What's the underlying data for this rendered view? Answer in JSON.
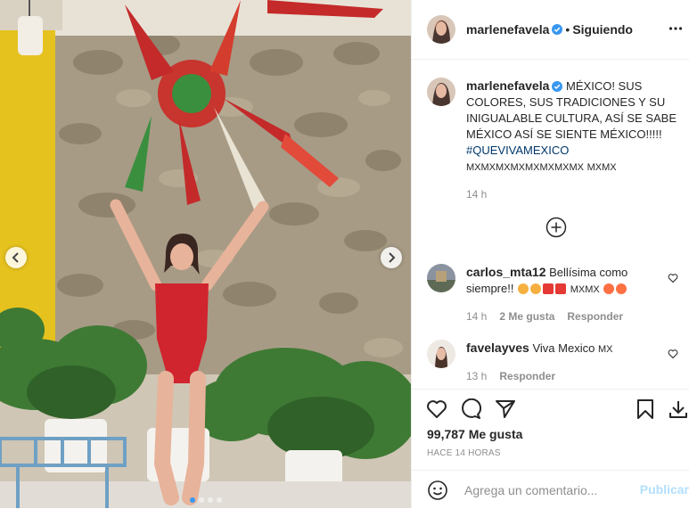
{
  "post": {
    "author": {
      "username": "marlenefavela",
      "verified": true,
      "follow_status": "Siguiendo",
      "separator": "•"
    },
    "caption": {
      "text": "MÉXICO! SUS COLORES, SUS TRADICIONES Y SU INIGUALABLE CULTURA, ASÍ SE SABE MÉXICO ASÍ SE SIENTE MÉXICO!!!!!",
      "hashtag": "#QUEVIVAMEXICO",
      "emoji_text": "MXMXMXMXMXMXMXMX",
      "emoji_text_2": "MXMX",
      "time": "14 h"
    },
    "comments": [
      {
        "username": "carlos_mta12",
        "text": "Bellísima como siempre!!",
        "trailing": "MXMX",
        "time": "14 h",
        "likes": "2 Me gusta",
        "reply": "Responder"
      },
      {
        "username": "favelayves",
        "text": "Viva Mexico",
        "trailing": "MX",
        "time": "13 h",
        "reply": "Responder"
      }
    ],
    "likes_count": "99,787 Me gusta",
    "posted_ago": "HACE 14 HORAS",
    "add_comment": {
      "placeholder": "Agrega un comentario...",
      "publish_label": "Publicar"
    },
    "carousel": {
      "slides": 4,
      "active": 1
    }
  },
  "colors": {
    "verified": "#3897f0",
    "link": "#00376b",
    "muted": "#8e8e8e",
    "publish_disabled": "#b2dffc",
    "swimsuit": "#d0242f",
    "wall_yellow": "#e6c21f"
  },
  "icons": [
    "chevron-left-icon",
    "chevron-right-icon",
    "more-icon",
    "verified-icon",
    "plus-circle-icon",
    "heart-icon",
    "comment-icon",
    "share-icon",
    "bookmark-icon",
    "download-icon",
    "emoji-icon"
  ]
}
